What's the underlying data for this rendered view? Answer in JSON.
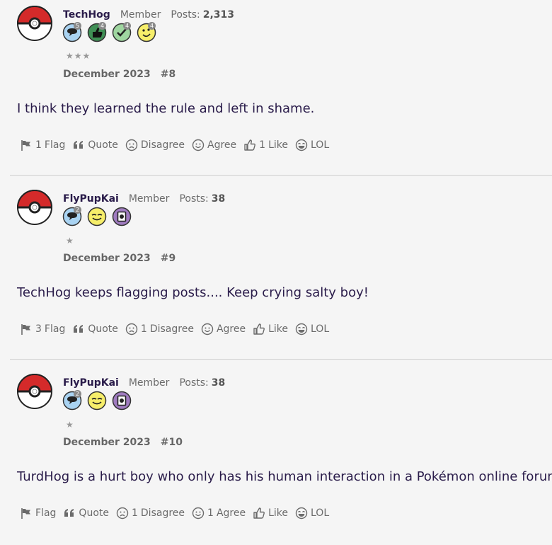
{
  "posts": [
    {
      "author": "TechHog",
      "role": "Member",
      "posts_label": "Posts:",
      "posts_count": "2,313",
      "badges": [
        {
          "icon": "speech-bubble-badge-icon",
          "count": "5"
        },
        {
          "icon": "thumbs-up-badge-icon",
          "count": "4"
        },
        {
          "icon": "checkmark-badge-icon",
          "count": "4"
        },
        {
          "icon": "smiley-badge-icon",
          "count": "4"
        }
      ],
      "stars": "★★★",
      "date": "December 2023",
      "number": "#8",
      "body": "I think they learned the rule and left in shame.",
      "actions": {
        "flag": {
          "count": "1",
          "label": "Flag"
        },
        "quote": {
          "label": "Quote"
        },
        "disagree": {
          "count": "",
          "label": "Disagree"
        },
        "agree": {
          "count": "",
          "label": "Agree"
        },
        "like": {
          "count": "1",
          "label": "Like"
        },
        "lol": {
          "label": "LOL"
        }
      }
    },
    {
      "author": "FlyPupKai",
      "role": "Member",
      "posts_label": "Posts:",
      "posts_count": "38",
      "badges": [
        {
          "icon": "speech-bubble-badge-icon",
          "count": "2"
        },
        {
          "icon": "wink-badge-icon",
          "count": ""
        },
        {
          "icon": "photo-badge-icon",
          "count": ""
        }
      ],
      "stars": "★",
      "date": "December 2023",
      "number": "#9",
      "body": "TechHog keeps flagging posts.... Keep crying salty boy!",
      "actions": {
        "flag": {
          "count": "3",
          "label": "Flag"
        },
        "quote": {
          "label": "Quote"
        },
        "disagree": {
          "count": "1",
          "label": "Disagree"
        },
        "agree": {
          "count": "",
          "label": "Agree"
        },
        "like": {
          "count": "",
          "label": "Like"
        },
        "lol": {
          "label": "LOL"
        }
      }
    },
    {
      "author": "FlyPupKai",
      "role": "Member",
      "posts_label": "Posts:",
      "posts_count": "38",
      "badges": [
        {
          "icon": "speech-bubble-badge-icon",
          "count": "2"
        },
        {
          "icon": "wink-badge-icon",
          "count": ""
        },
        {
          "icon": "photo-badge-icon",
          "count": ""
        }
      ],
      "stars": "★",
      "date": "December 2023",
      "number": "#10",
      "body": "TurdHog is a hurt boy who only has his human interaction in a Pokémon online forum.",
      "actions": {
        "flag": {
          "count": "",
          "label": "Flag"
        },
        "quote": {
          "label": "Quote"
        },
        "disagree": {
          "count": "1",
          "label": "Disagree"
        },
        "agree": {
          "count": "1",
          "label": "Agree"
        },
        "like": {
          "count": "",
          "label": "Like"
        },
        "lol": {
          "label": "LOL"
        }
      }
    }
  ],
  "colors": {
    "background": "#f5f5f5",
    "text": "#2a1c4a",
    "muted": "#6b6b6b",
    "divider": "#cfcfcf",
    "pokeball_red": "#d42a2a"
  }
}
